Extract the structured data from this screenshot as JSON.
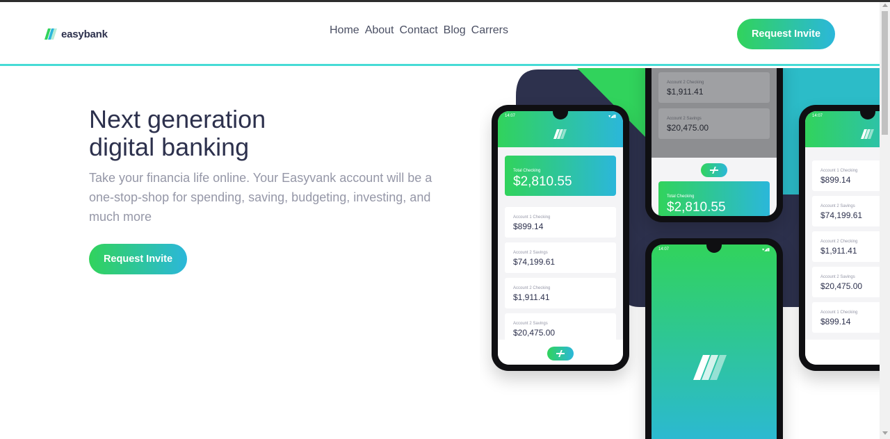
{
  "brand": {
    "name": "easybank",
    "accent_start": "#31d35c",
    "accent_end": "#2bb7da",
    "dark": "#2d314d"
  },
  "nav": {
    "links": [
      "Home",
      "About",
      "Contact",
      "Blog",
      "Carrers"
    ],
    "cta_label": "Request Invite"
  },
  "hero": {
    "title_line1": "Next generation",
    "title_line2": "digital banking",
    "description": "Take your financia life online. Your Easyvank account will be a one-stop-shop for spending, saving, budgeting, investing, and much more",
    "cta_label": "Request Invite"
  },
  "phones": {
    "time": "14:07",
    "total_label": "Total Checking",
    "total_amount": "$2,810.55",
    "accounts": [
      {
        "label": "Account 1 Checking",
        "amount": "$899.14"
      },
      {
        "label": "Account 2 Savings",
        "amount": "$74,199.61"
      },
      {
        "label": "Account 2 Checking",
        "amount": "$1,911.41"
      },
      {
        "label": "Account 2 Savings",
        "amount": "$20,475.00"
      },
      {
        "label": "Account 1 Checking",
        "amount": "$899.14"
      }
    ]
  }
}
